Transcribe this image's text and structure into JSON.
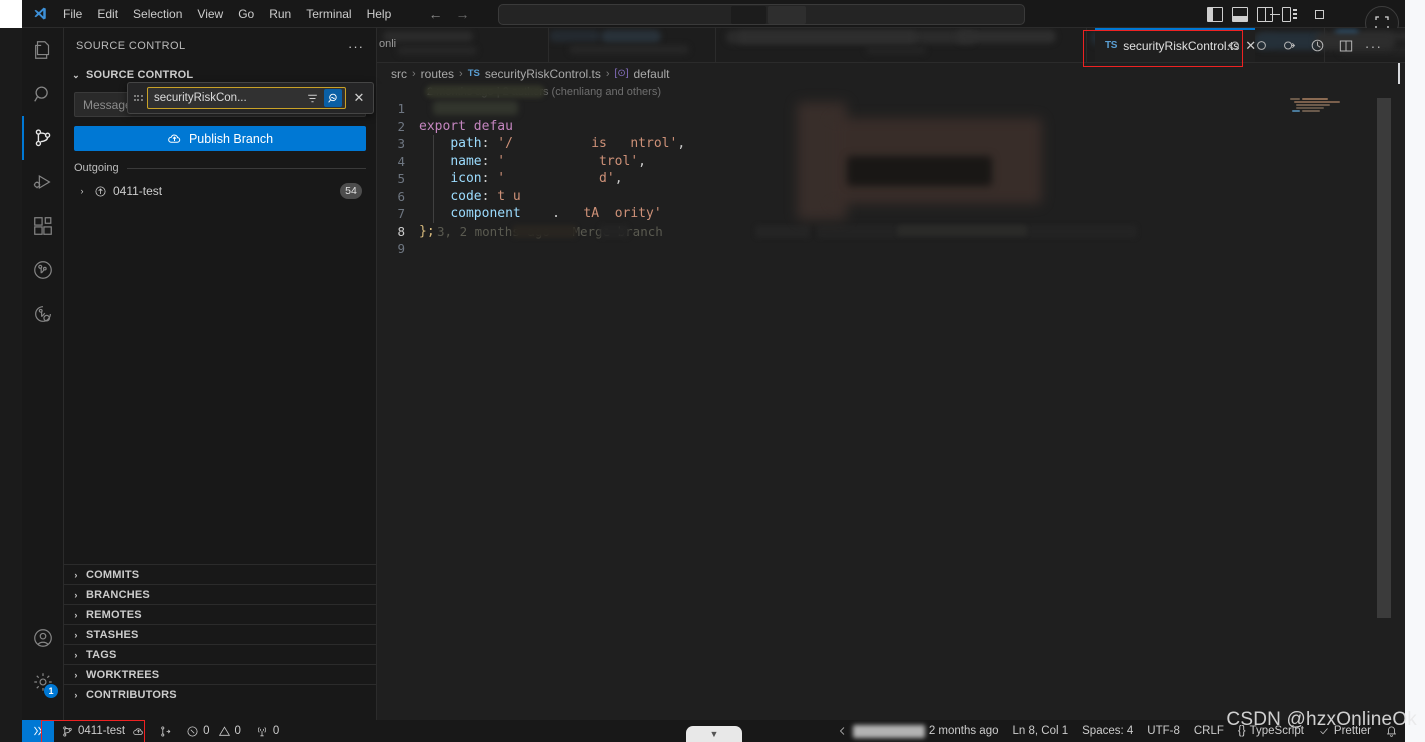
{
  "window": {
    "menu": [
      "File",
      "Edit",
      "Selection",
      "View",
      "Go",
      "Run",
      "Terminal",
      "Help"
    ],
    "logo_name": "vscode-logo",
    "nav_back": "←",
    "nav_forward": "→",
    "command_center_placeholder": "",
    "layout_icons": [
      "toggle-primary-sidebar-icon",
      "toggle-panel-icon",
      "toggle-secondary-sidebar-icon",
      "customize-layout-icon"
    ],
    "minimize": "—",
    "maximize": "□",
    "close": "✕"
  },
  "activitybar": {
    "items": [
      {
        "name": "explorer",
        "label": "Explorer",
        "active": false
      },
      {
        "name": "search",
        "label": "Search",
        "active": false
      },
      {
        "name": "source-control",
        "label": "Source Control",
        "active": true
      },
      {
        "name": "run-and-debug",
        "label": "Run and Debug",
        "active": false
      },
      {
        "name": "extensions",
        "label": "Extensions",
        "active": false
      },
      {
        "name": "gitlens",
        "label": "GitLens",
        "active": false
      },
      {
        "name": "gitlens-inspect",
        "label": "GitLens Inspect",
        "active": false
      }
    ],
    "accounts_label": "Accounts",
    "settings_label": "Manage",
    "settings_badge": "1"
  },
  "sidebar": {
    "title": "SOURCE CONTROL",
    "more_actions": "···",
    "scm_section_label": "SOURCE CONTROL",
    "message_placeholder": "Message (Ctrl+Enter to commit on '0411-test')",
    "message_visible_text": "Message (Ctrl+Ente",
    "find_widget": {
      "value": "securityRiskCon...",
      "filter_icon": "filter-icon",
      "match_icon": "search-match-icon",
      "close_icon": "✕"
    },
    "publish_button": "Publish Branch",
    "publish_icon": "cloud-upload-icon",
    "outgoing_label": "Outgoing",
    "branch": {
      "name": "0411-test",
      "icon": "arrow-up-circle-icon",
      "badge": "54",
      "chevron": "›"
    },
    "sections": [
      {
        "label": "COMMITS"
      },
      {
        "label": "BRANCHES"
      },
      {
        "label": "REMOTES"
      },
      {
        "label": "STASHES"
      },
      {
        "label": "TAGS"
      },
      {
        "label": "WORKTREES"
      },
      {
        "label": "CONTRIBUTORS"
      }
    ]
  },
  "tabs": {
    "active": {
      "label": "securityRiskControl.ts",
      "badge": "TS",
      "close": "✕"
    },
    "hidden_tab_text": "onli",
    "editor_actions": [
      {
        "name": "go-back-revision-icon"
      },
      {
        "name": "current-revision-icon"
      },
      {
        "name": "go-forward-revision-icon"
      },
      {
        "name": "toggle-file-blame-icon"
      },
      {
        "name": "split-editor-icon"
      },
      {
        "name": "more-actions-icon"
      }
    ]
  },
  "breadcrumb": {
    "parts": [
      "src",
      "routes",
      "securityRiskControl.ts",
      "default"
    ],
    "file_badge": "TS",
    "symbol_badge": "[⊙]",
    "separator": "›"
  },
  "editor": {
    "blame_header": "2 months ago | 2 authors (chenliang and others)",
    "lines": [
      {
        "num": "1",
        "text": ""
      },
      {
        "num": "2",
        "text": "export defau"
      },
      {
        "num": "3",
        "text": "    path: '/            is    ntrol',"
      },
      {
        "num": "4",
        "text": "    name: '                trol',"
      },
      {
        "num": "5",
        "text": "    icon: '              d',"
      },
      {
        "num": "6",
        "text": "    code: t  u"
      },
      {
        "num": "7",
        "text": "    component        .    tA    ority'"
      },
      {
        "num": "8",
        "text": "};"
      },
      {
        "num": "9",
        "text": ""
      }
    ],
    "inline_blame": "3, 2 months ago • Merge branch"
  },
  "statusbar": {
    "remote_icon": "remote-window-icon",
    "branch": "0411-test",
    "sync_icon": "cloud-sync-icon",
    "publish_icon": "publish-changes-icon",
    "errors": "0",
    "warnings": "0",
    "ports": "0",
    "error_icon": "error-circle-icon",
    "warning_icon": "warning-triangle-icon",
    "ports_icon": "radio-tower-icon",
    "blame_time": "2 months ago",
    "cursor": "Ln 8, Col 1",
    "indentation": "Spaces: 4",
    "encoding": "UTF-8",
    "eol": "CRLF",
    "language": "TypeScript",
    "language_icon": "{}",
    "formatter": "Prettier",
    "notification_icon": "▼"
  },
  "watermark": "CSDN @hzxOnlineOk",
  "colors": {
    "accent": "#0078d4",
    "annotation": "#ee2222",
    "sidebar_bg": "#181818",
    "editor_bg": "#1f1f1f"
  }
}
